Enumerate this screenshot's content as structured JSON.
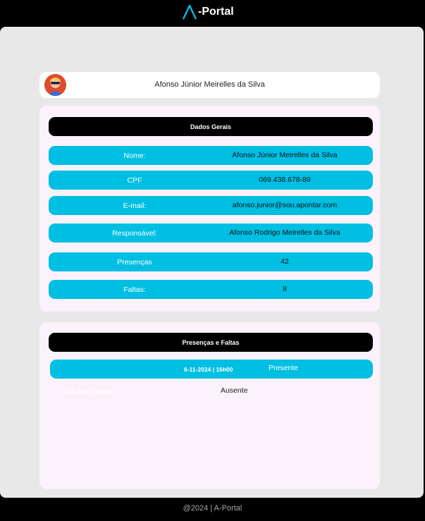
{
  "header": {
    "logo_text": "-Portal",
    "logo_icon": "chevron-up-icon"
  },
  "user": {
    "name": "Afonso Júnior Meirelles da Silva",
    "avatar_icon": "avatar-icon"
  },
  "general": {
    "title": "Dados Gerais",
    "rows": [
      {
        "label": "Nome:",
        "value": "Afonso Júnior Meirelles da Silva"
      },
      {
        "label": "CPF",
        "value": "069.438.678-89"
      },
      {
        "label": "E-mail:",
        "value": "afonso.junior@sou.apontar.com"
      },
      {
        "label": "Responsável:",
        "value": "Afonso Rodrigo Meirelles da Silva"
      },
      {
        "label": "Presenças",
        "value": "42"
      },
      {
        "label": "Faltas:",
        "value": "8"
      }
    ]
  },
  "attendance": {
    "title": "Presenças e Faltas",
    "entries": [
      {
        "date": "6-11-2024 | 16h00",
        "status": "Presente"
      },
      {
        "date": "4-11-2024 | 16h00",
        "status": "Ausente"
      }
    ]
  },
  "footer": {
    "text": "@2024 | A-Portal"
  },
  "colors": {
    "accent": "#00bfe3",
    "panel": "#e8e8e8",
    "card": "#fbf2fb"
  }
}
